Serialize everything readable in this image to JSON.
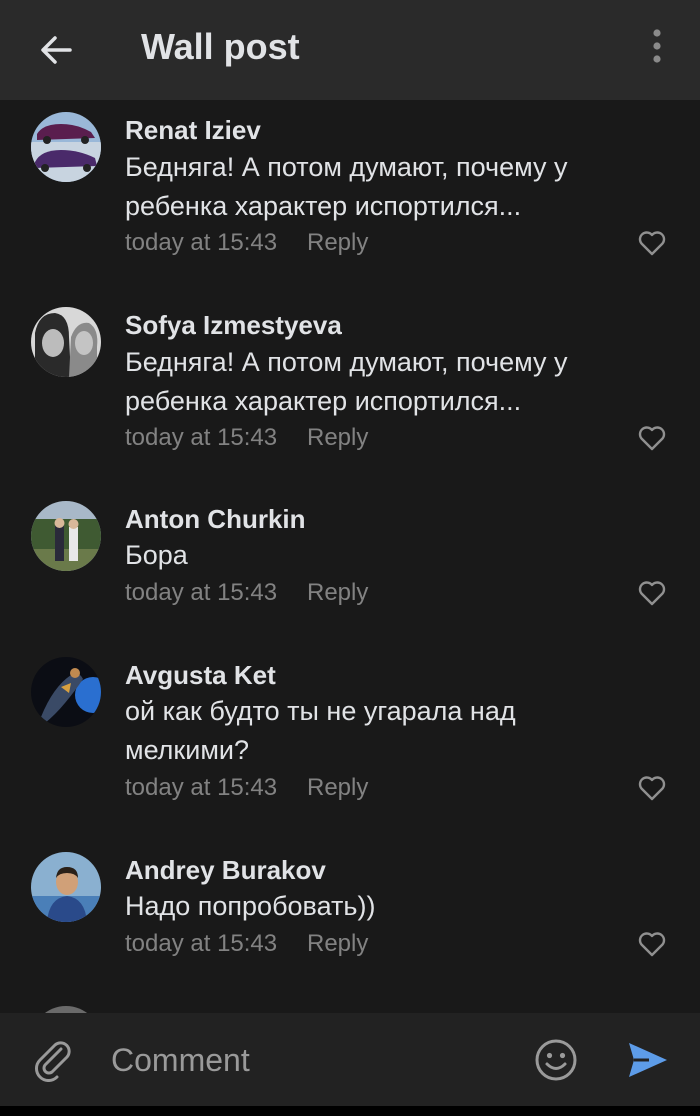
{
  "header": {
    "title": "Wall post",
    "back_icon": "arrow-left-icon",
    "menu_icon": "more-vertical-icon"
  },
  "comments": [
    {
      "author": "Renat Iziev",
      "text": "Бедняга! А потом думают, почему у ребенка характер испортился...",
      "time": "today at 15:43",
      "reply_label": "Reply"
    },
    {
      "author": "Sofya Izmestyeva",
      "text": "Бедняга! А потом думают, почему у ребенка характер испортился...",
      "time": "today at 15:43",
      "reply_label": "Reply"
    },
    {
      "author": "Anton Churkin",
      "text": "Бора",
      "time": "today at 15:43",
      "reply_label": "Reply"
    },
    {
      "author": "Avgusta Ket",
      "text": "ой как будто ты не угарала над мелкими?",
      "time": "today at 15:43",
      "reply_label": "Reply"
    },
    {
      "author": "Andrey Burakov",
      "text": "Надо попробовать))",
      "time": "today at 15:43",
      "reply_label": "Reply"
    }
  ],
  "composer": {
    "placeholder": "Comment",
    "attach_icon": "paperclip-icon",
    "emoji_icon": "smiley-icon",
    "send_icon": "send-icon"
  },
  "colors": {
    "background": "#191919",
    "header": "#2a2a2a",
    "text_primary": "#e1e3e6",
    "text_secondary": "#828282",
    "accent": "#5d9ce8"
  }
}
